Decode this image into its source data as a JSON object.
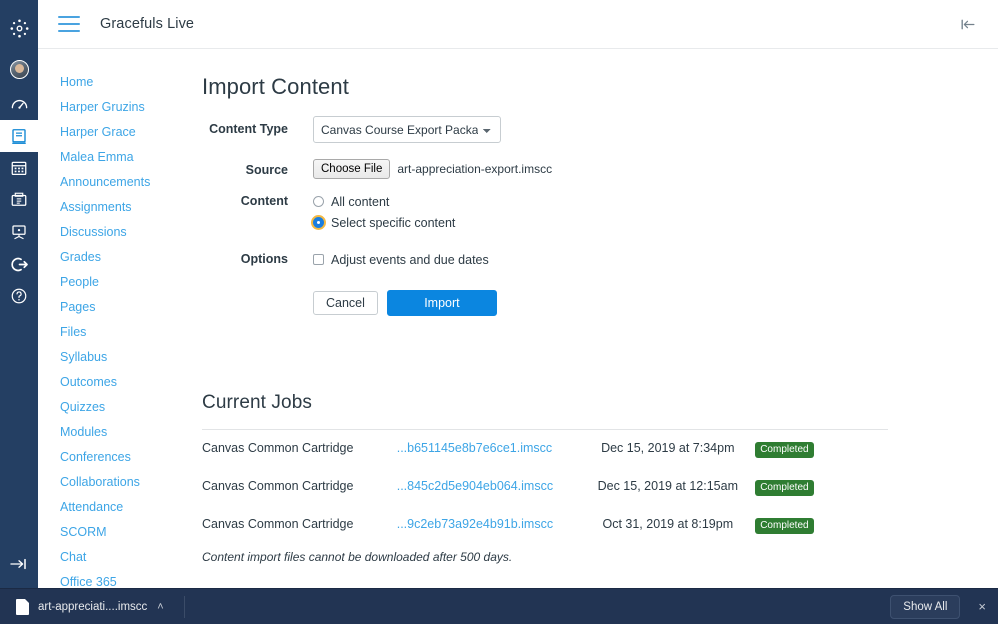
{
  "global_nav": {
    "items": [
      {
        "name": "canvas-logo",
        "label": "Canvas"
      },
      {
        "name": "account-avatar",
        "label": "Account"
      },
      {
        "name": "dashboard",
        "label": "Dashboard"
      },
      {
        "name": "courses",
        "label": "Courses"
      },
      {
        "name": "calendar",
        "label": "Calendar"
      },
      {
        "name": "inbox",
        "label": "Inbox"
      },
      {
        "name": "studio",
        "label": "Studio"
      },
      {
        "name": "logout",
        "label": "Logout"
      },
      {
        "name": "help",
        "label": "Help"
      }
    ],
    "collapse_label": "Minimize Global Navigation"
  },
  "topbar": {
    "menu_label": "Menu",
    "course_title": "Gracefuls Live",
    "collapse_label": "Collapse course navigation"
  },
  "course_nav": {
    "items": [
      "Home",
      "Harper Gruzins",
      "Harper Grace",
      "Malea Emma",
      "Announcements",
      "Assignments",
      "Discussions",
      "Grades",
      "People",
      "Pages",
      "Files",
      "Syllabus",
      "Outcomes",
      "Quizzes",
      "Modules",
      "Conferences",
      "Collaborations",
      "Attendance",
      "SCORM",
      "Chat",
      "Office 365"
    ]
  },
  "import": {
    "page_title": "Import Content",
    "content_type_label": "Content Type",
    "content_type_value": "Canvas Course Export Package",
    "content_type_options": [
      "Canvas Course Export Package"
    ],
    "source_label": "Source",
    "choose_file_label": "Choose File",
    "file_name": "art-appreciation-export.imscc",
    "content_label": "Content",
    "radio_all_label": "All content",
    "radio_specific_label": "Select specific content",
    "radio_selected": "Select specific content",
    "options_label": "Options",
    "adjust_dates_label": "Adjust events and due dates",
    "adjust_dates_checked": false,
    "cancel_label": "Cancel",
    "import_label": "Import",
    "accent_color": "#0b86e0",
    "focus_ring_color": "#f4b942"
  },
  "jobs": {
    "title": "Current Jobs",
    "note": "Content import files cannot be downloaded after 500 days.",
    "status_color": "#2f7d32",
    "rows": [
      {
        "type": "Canvas Common Cartridge",
        "file": "...b651145e8b7e6ce1.imscc",
        "date": "Dec 15, 2019 at 7:34pm",
        "status": "Completed"
      },
      {
        "type": "Canvas Common Cartridge",
        "file": "...845c2d5e904eb064.imscc",
        "date": "Dec 15, 2019 at 12:15am",
        "status": "Completed"
      },
      {
        "type": "Canvas Common Cartridge",
        "file": "...9c2eb73a92e4b91b.imscc",
        "date": "Oct 31, 2019 at 8:19pm",
        "status": "Completed"
      }
    ]
  },
  "download_bar": {
    "file_name": "art-appreciati....imscc",
    "caret": "˄",
    "show_all_label": "Show All",
    "close_label": "×"
  }
}
